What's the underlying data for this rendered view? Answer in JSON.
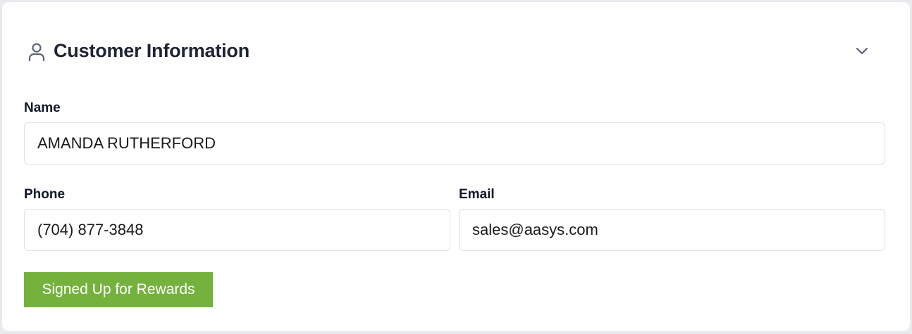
{
  "section": {
    "title": "Customer Information",
    "icon": "user-icon",
    "collapse_icon": "chevron-down-icon"
  },
  "fields": {
    "name": {
      "label": "Name",
      "value": "AMANDA RUTHERFORD"
    },
    "phone": {
      "label": "Phone",
      "value": "(704) 877-3848"
    },
    "email": {
      "label": "Email",
      "value": "sales@aasys.com"
    }
  },
  "rewards_button": {
    "label": "Signed Up for Rewards",
    "color": "#74b23d"
  },
  "colors": {
    "title_text": "#1e2433",
    "field_border": "#dde1e7",
    "icon_stroke": "#5b6478"
  }
}
